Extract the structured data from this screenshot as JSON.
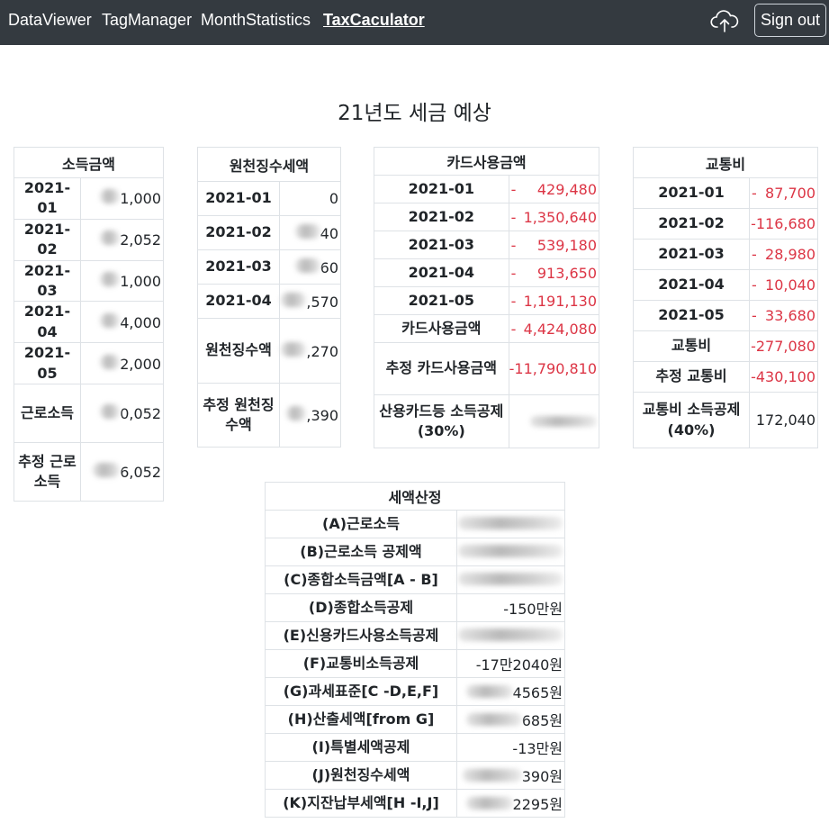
{
  "nav": {
    "links": [
      "DataViewer",
      "TagManager",
      "MonthStatistics",
      "TaxCaculator"
    ],
    "upload_icon": "cloud-upload-icon",
    "signout": "Sign out"
  },
  "title": "21년도 세금 예상",
  "income": {
    "header": "소득금액",
    "rows": [
      {
        "label": "2021-01",
        "value": "1,000"
      },
      {
        "label": "2021-02",
        "value": "2,052"
      },
      {
        "label": "2021-03",
        "value": "1,000"
      },
      {
        "label": "2021-04",
        "value": "4,000"
      },
      {
        "label": "2021-05",
        "value": "2,000"
      },
      {
        "label": "근로소득",
        "value": "0,052"
      },
      {
        "label": "추정 근로소득",
        "value": "6,052"
      }
    ]
  },
  "withholding": {
    "header": "원천징수세액",
    "rows": [
      {
        "label": "2021-01",
        "value": "0"
      },
      {
        "label": "2021-02",
        "value": "40"
      },
      {
        "label": "2021-03",
        "value": "60"
      },
      {
        "label": "2021-04",
        "value": ",570"
      },
      {
        "label": "원천징수액",
        "value": ",270"
      },
      {
        "label": "추정 원천징수액",
        "value": ",390"
      }
    ]
  },
  "card": {
    "header": "카드사용금액",
    "rows": [
      {
        "label": "2021-01",
        "value": "429,480"
      },
      {
        "label": "2021-02",
        "value": "1,350,640"
      },
      {
        "label": "2021-03",
        "value": "539,180"
      },
      {
        "label": "2021-04",
        "value": "913,650"
      },
      {
        "label": "2021-05",
        "value": "1,191,130"
      },
      {
        "label": "카드사용금액",
        "value": "4,424,080"
      },
      {
        "label": "추정 카드사용금액",
        "value": "-11,790,810"
      },
      {
        "label": "산용카드등 소득공제(30%)",
        "value": ""
      }
    ]
  },
  "transport": {
    "header": "교통비",
    "rows": [
      {
        "label": "2021-01",
        "value": "87,700"
      },
      {
        "label": "2021-02",
        "value": "-116,680"
      },
      {
        "label": "2021-03",
        "value": "28,980"
      },
      {
        "label": "2021-04",
        "value": "10,040"
      },
      {
        "label": "2021-05",
        "value": "33,680"
      },
      {
        "label": "교통비",
        "value": "-277,080"
      },
      {
        "label": "추정 교통비",
        "value": "-430,100"
      },
      {
        "label": "교통비 소득공제(40%)",
        "value": "172,040"
      }
    ]
  },
  "tax": {
    "header": "세액산정",
    "rows": [
      {
        "label": "(A)근로소득",
        "value": ""
      },
      {
        "label": "(B)근로소득 공제액",
        "value": ""
      },
      {
        "label": "(C)종합소득금액[A - B]",
        "value": ""
      },
      {
        "label": "(D)종합소득공제",
        "value": "-150만원"
      },
      {
        "label": "(E)신용카드사용소득공제",
        "value": ""
      },
      {
        "label": "(F)교통비소득공제",
        "value": "-17만2040원"
      },
      {
        "label": "(G)과세표준[C -D,E,F]",
        "value": "4565원"
      },
      {
        "label": "(H)산출세액[from G]",
        "value": "685원"
      },
      {
        "label": "(I)특별세액공제",
        "value": "-13만원"
      },
      {
        "label": "(J)원천징수세액",
        "value": "390원"
      },
      {
        "label": "(K)지잔납부세액[H -I,J]",
        "value": "2295원"
      }
    ]
  },
  "colors": {
    "navbar": "#343a40",
    "negative": "#dc3545",
    "border": "#dee2e6"
  }
}
